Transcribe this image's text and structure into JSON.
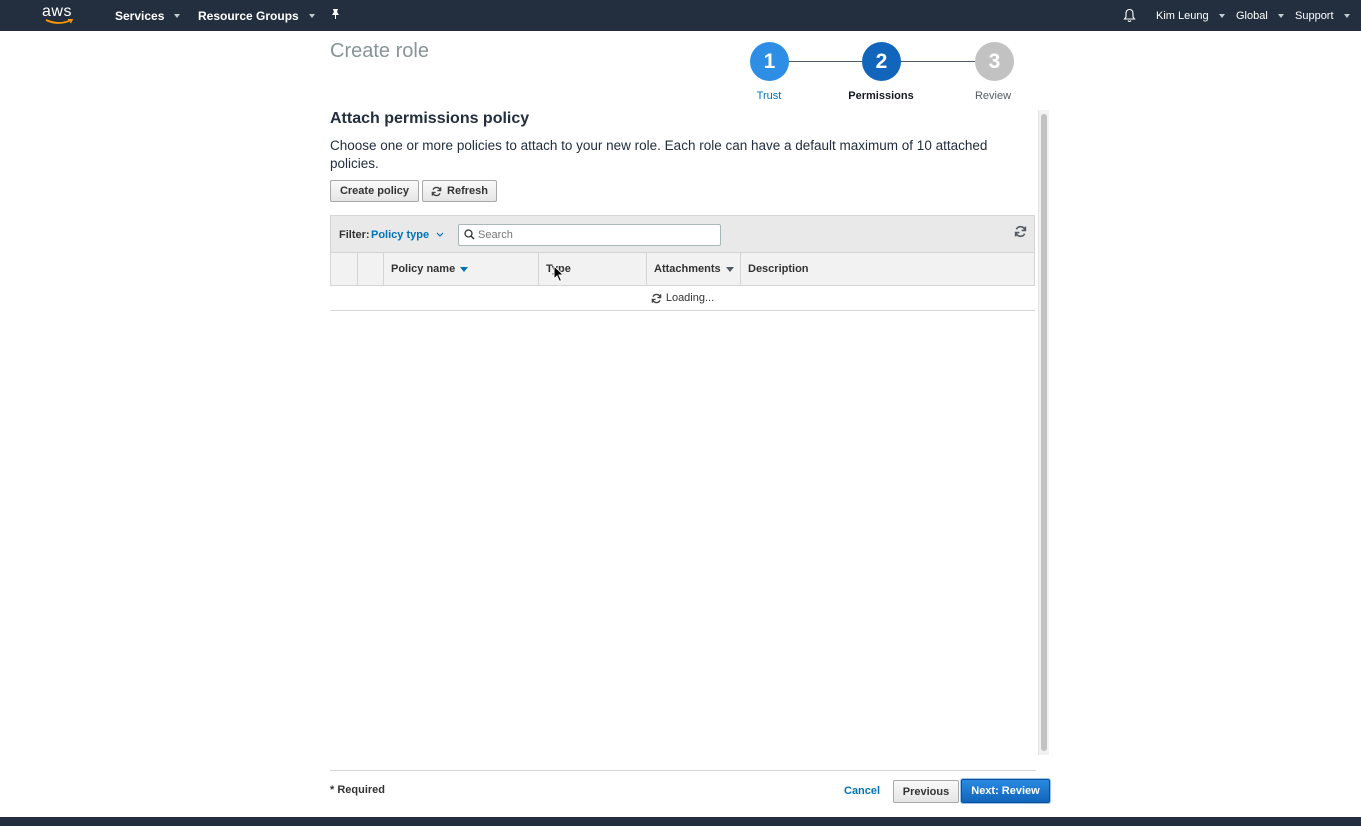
{
  "topnav": {
    "logo_text": "aws",
    "services_label": "Services",
    "resource_groups_label": "Resource Groups",
    "user_label": "Kim Leung",
    "region_label": "Global",
    "support_label": "Support"
  },
  "page": {
    "title": "Create role"
  },
  "steps": [
    {
      "number": "1",
      "label": "Trust",
      "state": "completed"
    },
    {
      "number": "2",
      "label": "Permissions",
      "state": "current"
    },
    {
      "number": "3",
      "label": "Review",
      "state": "upcoming"
    }
  ],
  "section": {
    "title": "Attach permissions policy",
    "description": "Choose one or more policies to attach to your new role. Each role can have a default maximum of 10 attached policies."
  },
  "actions": {
    "create_policy_label": "Create policy",
    "refresh_label": "Refresh"
  },
  "filter": {
    "label": "Filter:",
    "value": "Policy type",
    "search_placeholder": "Search"
  },
  "table": {
    "columns": [
      "Policy name",
      "Type",
      "Attachments",
      "Description"
    ],
    "loading_text": "Loading..."
  },
  "footer": {
    "required_label": "* Required",
    "cancel_label": "Cancel",
    "previous_label": "Previous",
    "next_label": "Next: Review"
  },
  "colors": {
    "nav_bg": "#232f3e",
    "step_complete": "#2e8ee6",
    "step_current": "#1166bb",
    "step_upcoming": "#c2c2c2",
    "link": "#0073bb",
    "primary_button": "#1166bb"
  },
  "icons": [
    "bell-icon",
    "pin-icon",
    "refresh-icon",
    "search-icon",
    "sync-icon",
    "spinner-icon"
  ]
}
